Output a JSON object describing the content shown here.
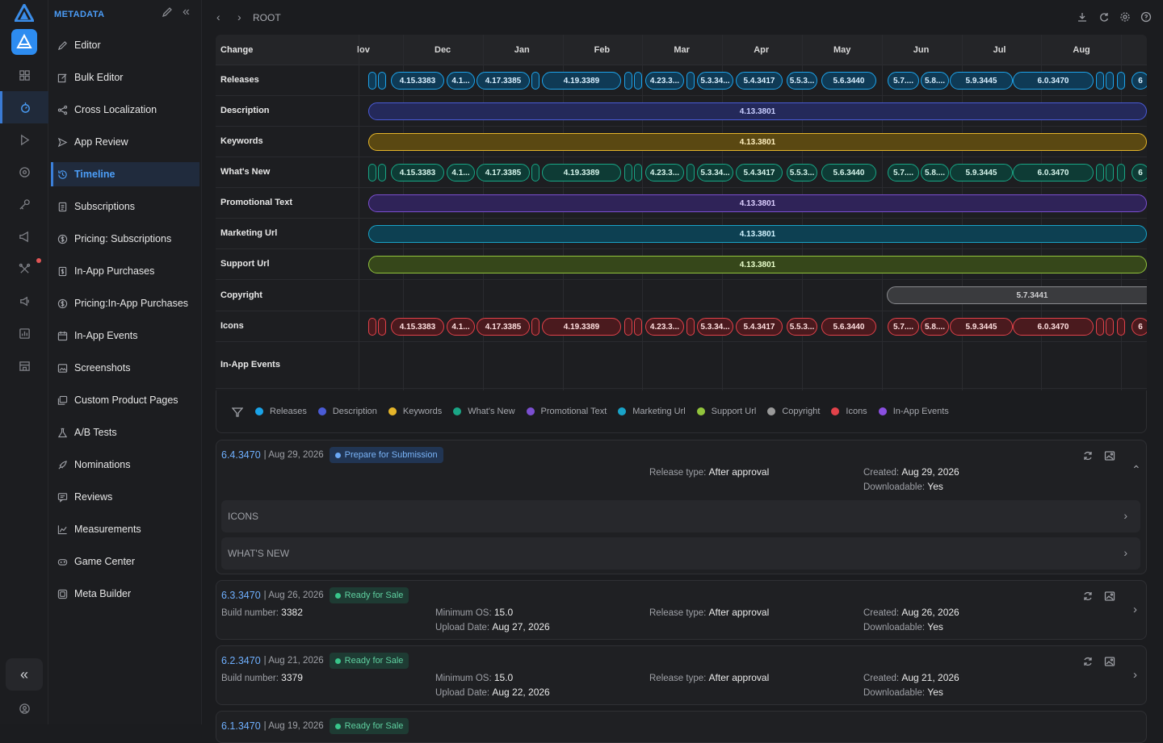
{
  "sidebar": {
    "header": "METADATA",
    "items": [
      {
        "label": "Editor",
        "icon": "pencil-icon"
      },
      {
        "label": "Bulk Editor",
        "icon": "edit-square-icon"
      },
      {
        "label": "Cross Localization",
        "icon": "share-icon"
      },
      {
        "label": "App Review",
        "icon": "send-icon"
      },
      {
        "label": "Timeline",
        "icon": "history-icon",
        "active": true
      },
      {
        "label": "Subscriptions",
        "icon": "document-icon"
      },
      {
        "label": "Pricing: Subscriptions",
        "icon": "dollar-icon"
      },
      {
        "label": "In-App Purchases",
        "icon": "dollar-doc-icon"
      },
      {
        "label": "Pricing:In-App Purchases",
        "icon": "dollar-icon"
      },
      {
        "label": "In-App Events",
        "icon": "calendar-icon"
      },
      {
        "label": "Screenshots",
        "icon": "image-icon"
      },
      {
        "label": "Custom Product Pages",
        "icon": "images-icon"
      },
      {
        "label": "A/B Tests",
        "icon": "flask-icon"
      },
      {
        "label": "Nominations",
        "icon": "rocket-icon"
      },
      {
        "label": "Reviews",
        "icon": "review-icon"
      },
      {
        "label": "Measurements",
        "icon": "chart-icon"
      },
      {
        "label": "Game Center",
        "icon": "gamepad-icon"
      },
      {
        "label": "Meta Builder",
        "icon": "layers-icon"
      }
    ]
  },
  "breadcrumb": "ROOT",
  "timeline": {
    "header_label": "Change",
    "months": [
      "lov",
      "Dec",
      "Jan",
      "Feb",
      "Mar",
      "Apr",
      "May",
      "Jun",
      "Jul",
      "Aug"
    ],
    "rows": [
      "Releases",
      "Description",
      "Keywords",
      "What's New",
      "Promotional Text",
      "Marketing Url",
      "Support Url",
      "Copyright",
      "Icons",
      "In-App Events"
    ],
    "release_pills": [
      "4.15.3383",
      "4.1...",
      "4.17.3385",
      "4.19.3389",
      "4.23.3...",
      "5.3.34...",
      "5.4.3417",
      "5.5.3...",
      "5.6.3440",
      "5.7....",
      "5.8....",
      "5.9.3445",
      "6.0.3470",
      "6"
    ],
    "description_value": "4.13.3801",
    "keywords_value": "4.13.3801",
    "promotional_value": "4.13.3801",
    "marketing_value": "4.13.3801",
    "support_value": "4.13.3801",
    "copyright_value": "5.7.3441"
  },
  "legend": [
    {
      "label": "Releases",
      "color": "#1aa3e8"
    },
    {
      "label": "Description",
      "color": "#4a5bd6"
    },
    {
      "label": "Keywords",
      "color": "#e5b52a"
    },
    {
      "label": "What's New",
      "color": "#1aa585"
    },
    {
      "label": "Promotional Text",
      "color": "#7b4fd0"
    },
    {
      "label": "Marketing Url",
      "color": "#19a3c8"
    },
    {
      "label": "Support Url",
      "color": "#92c43c"
    },
    {
      "label": "Copyright",
      "color": "#9a9a9a"
    },
    {
      "label": "Icons",
      "color": "#e2424a"
    },
    {
      "label": "In-App Events",
      "color": "#8a4fe0"
    }
  ],
  "labels": {
    "release_type": "Release type:",
    "created": "Created:",
    "downloadable": "Downloadable:",
    "build_number": "Build number:",
    "minimum_os": "Minimum OS:",
    "upload_date": "Upload Date:"
  },
  "versions": [
    {
      "version": "6.4.3470",
      "date": "| Aug 29, 2026",
      "status": "Prepare for Submission",
      "release_type": "After approval",
      "created": "Aug 29, 2026",
      "downloadable": "Yes",
      "sections": [
        "ICONS",
        "WHAT'S NEW"
      ]
    },
    {
      "version": "6.3.3470",
      "date": "| Aug 26, 2026",
      "status": "Ready for Sale",
      "build_number": "3382",
      "minimum_os": "15.0",
      "upload_date": "Aug 27, 2026",
      "release_type": "After approval",
      "created": "Aug 26, 2026",
      "downloadable": "Yes"
    },
    {
      "version": "6.2.3470",
      "date": "| Aug 21, 2026",
      "status": "Ready for Sale",
      "build_number": "3379",
      "minimum_os": "15.0",
      "upload_date": "Aug 22, 2026",
      "release_type": "After approval",
      "created": "Aug 21, 2026",
      "downloadable": "Yes"
    },
    {
      "version": "6.1.3470",
      "date": "| Aug 19, 2026",
      "status": "Ready for Sale"
    }
  ]
}
